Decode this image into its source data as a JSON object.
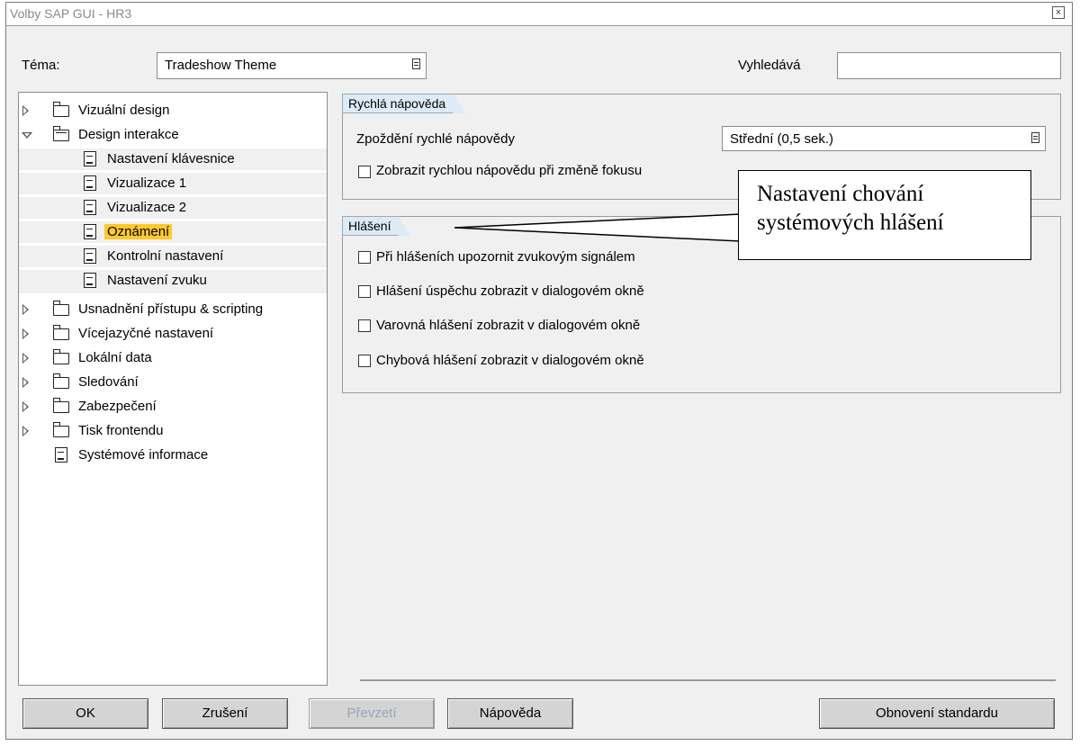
{
  "window": {
    "title": "Volby SAP GUI - HR3",
    "close_symbol": "×"
  },
  "top": {
    "theme_label": "Téma:",
    "theme_value": "Tradeshow Theme",
    "search_label": "Vyhledává",
    "search_value": ""
  },
  "tree": {
    "items": [
      {
        "label": "Vizuální design"
      },
      {
        "label": "Design interakce"
      },
      {
        "label": "Nastavení klávesnice"
      },
      {
        "label": "Vizualizace 1"
      },
      {
        "label": "Vizualizace 2"
      },
      {
        "label": "Oznámení"
      },
      {
        "label": "Kontrolní nastavení"
      },
      {
        "label": "Nastavení zvuku"
      },
      {
        "label": "Usnadnění přístupu & scripting"
      },
      {
        "label": "Vícejazyčné nastavení"
      },
      {
        "label": "Lokální data"
      },
      {
        "label": "Sledování"
      },
      {
        "label": "Zabezpečení"
      },
      {
        "label": "Tisk frontendu"
      },
      {
        "label": "Systémové informace"
      }
    ],
    "selected": "Oznámení"
  },
  "quickhelp": {
    "title": "Rychlá nápověda",
    "delay_label": "Zpoždění rychlé nápovědy",
    "delay_value": "Střední (0,5 sek.)",
    "focus_checkbox": "Zobrazit rychlou nápovědu při změně fokusu"
  },
  "messages": {
    "title": "Hlášení",
    "options": [
      {
        "label": "Při hlášeních upozornit zvukovým signálem",
        "checked": false
      },
      {
        "label": "Hlášení úspěchu zobrazit v dialogovém okně",
        "checked": false
      },
      {
        "label": "Varovná hlášení zobrazit v dialogovém okně",
        "checked": false
      },
      {
        "label": "Chybová hlášení zobrazit v dialogovém okně",
        "checked": false
      }
    ]
  },
  "callout": {
    "line1": "Nastavení chování",
    "line2": "systémových hlášení"
  },
  "buttons": {
    "ok": "OK",
    "cancel": "Zrušení",
    "apply": "Převzetí",
    "help": "Nápověda",
    "reset": "Obnovení standardu"
  }
}
